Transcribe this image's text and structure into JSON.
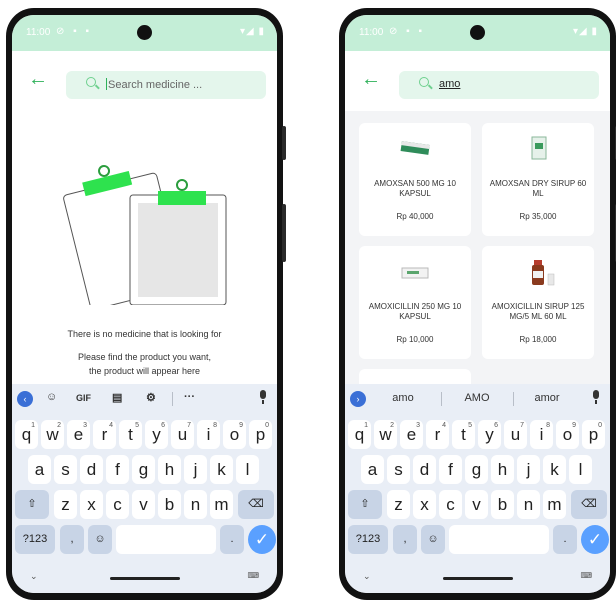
{
  "status": {
    "time": "11:00",
    "left_icons": "⊘ ▪ ▪",
    "right_icons": "▾◢ ▮"
  },
  "screen1": {
    "search_placeholder": "Search medicine ...",
    "empty_title": "There is no medicine that is looking for",
    "empty_line1": "Please find the product you want,",
    "empty_line2": "the product will appear here",
    "toolbar": {
      "gif": "GIF",
      "more": "···"
    }
  },
  "screen2": {
    "search_value": "amo",
    "products": [
      {
        "name": "AMOXSAN 500 MG 10 KAPSUL",
        "price": "Rp 40,000"
      },
      {
        "name": "AMOXSAN DRY SIRUP 60 ML",
        "price": "Rp 35,000"
      },
      {
        "name": "AMOXICILLIN 250 MG 10 KAPSUL",
        "price": "Rp 10,000"
      },
      {
        "name": "AMOXICILLIN SIRUP 125 MG/5 ML 60 ML",
        "price": "Rp 18,000"
      }
    ],
    "suggestions": [
      "amo",
      "AMO",
      "amor"
    ]
  },
  "keyboard": {
    "row1": [
      "q",
      "w",
      "e",
      "r",
      "t",
      "y",
      "u",
      "i",
      "o",
      "p"
    ],
    "row1_nums": [
      "1",
      "2",
      "3",
      "4",
      "5",
      "6",
      "7",
      "8",
      "9",
      "0"
    ],
    "row2": [
      "a",
      "s",
      "d",
      "f",
      "g",
      "h",
      "j",
      "k",
      "l"
    ],
    "row3": [
      "z",
      "x",
      "c",
      "v",
      "b",
      "n",
      "m"
    ],
    "shift": "⇧",
    "backspace": "⌫",
    "symbols": "?123",
    "comma": ",",
    "emoji": "☺",
    "period": ".",
    "enter": "✓",
    "collapse": "⌄",
    "switch": "⌨"
  },
  "colors": {
    "accent": "#2fb15a",
    "statusbar": "#c4eed7",
    "search_bg": "#e4f6ec",
    "keyboard_bg": "#e9eef6",
    "enter": "#5aa0ff"
  }
}
